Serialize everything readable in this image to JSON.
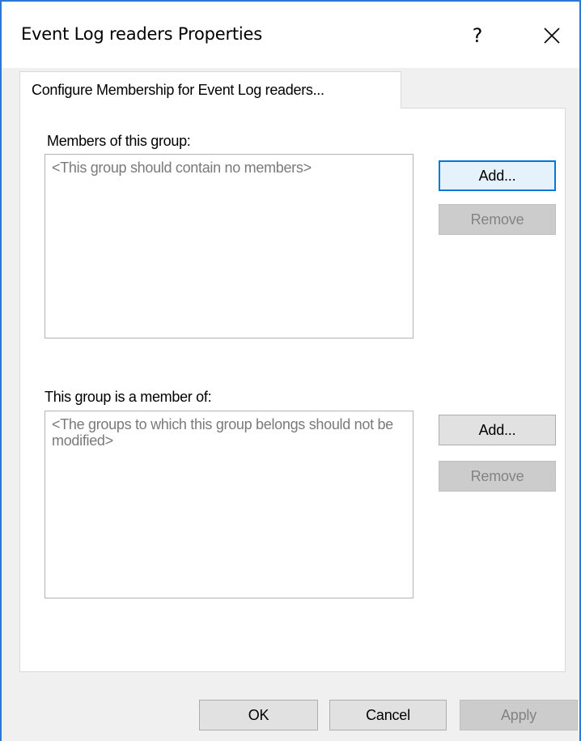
{
  "window": {
    "title": "Event Log readers Properties",
    "help_label": "?",
    "close_icon": "close-icon"
  },
  "tab": {
    "label": "Configure Membership for Event Log readers..."
  },
  "members": {
    "label": "Members of this group:",
    "list_text": "<This group should contain no members>",
    "add_label": "Add...",
    "remove_label": "Remove"
  },
  "member_of": {
    "label": "This group is a member of:",
    "list_text": "<The groups to which this group belongs should not be modified>",
    "add_label": "Add...",
    "remove_label": "Remove"
  },
  "footer": {
    "ok_label": "OK",
    "cancel_label": "Cancel",
    "apply_label": "Apply"
  },
  "colors": {
    "accent": "#0078d7",
    "window_border": "#2b78d6"
  }
}
